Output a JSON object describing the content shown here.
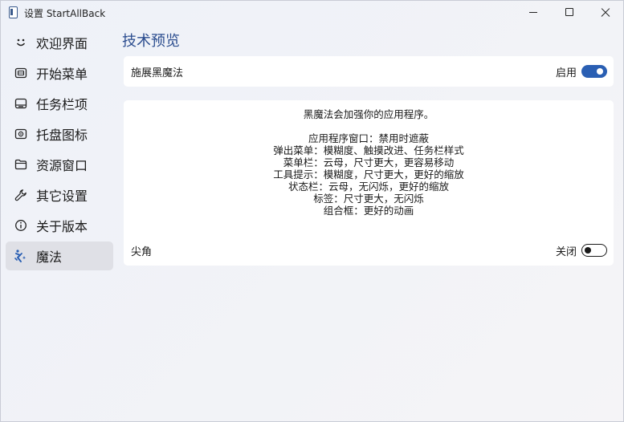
{
  "window": {
    "title": "设置 StartAllBack"
  },
  "sidebar": {
    "items": [
      {
        "label": "欢迎界面",
        "icon": "smiley-icon"
      },
      {
        "label": "开始菜单",
        "icon": "start-menu-icon"
      },
      {
        "label": "任务栏项",
        "icon": "taskbar-icon"
      },
      {
        "label": "托盘图标",
        "icon": "tray-icon"
      },
      {
        "label": "资源窗口",
        "icon": "folder-icon"
      },
      {
        "label": "其它设置",
        "icon": "wrench-icon"
      },
      {
        "label": "关于版本",
        "icon": "info-icon"
      },
      {
        "label": "魔法",
        "icon": "magic-icon"
      }
    ],
    "active_index": 7
  },
  "main": {
    "title": "技术预览",
    "black_magic": {
      "label": "施展黑魔法",
      "state_label": "启用",
      "enabled": true
    },
    "description": {
      "intro": "黑魔法会加强你的应用程序。",
      "lines": [
        "应用程序窗口：禁用时遮蔽",
        "弹出菜单：模糊度、触摸改进、任务栏样式",
        "菜单栏：云母，尺寸更大，更容易移动",
        "工具提示：模糊度，尺寸更大，更好的缩放",
        "状态栏：云母，无闪烁，更好的缩放",
        "标签：尺寸更大，无闪烁",
        "组合框：更好的动画"
      ]
    },
    "sharp_corners": {
      "label": "尖角",
      "state_label": "关闭",
      "enabled": false
    }
  },
  "colors": {
    "accent": "#2a5fb3",
    "title_blue": "#2b4d8f"
  }
}
